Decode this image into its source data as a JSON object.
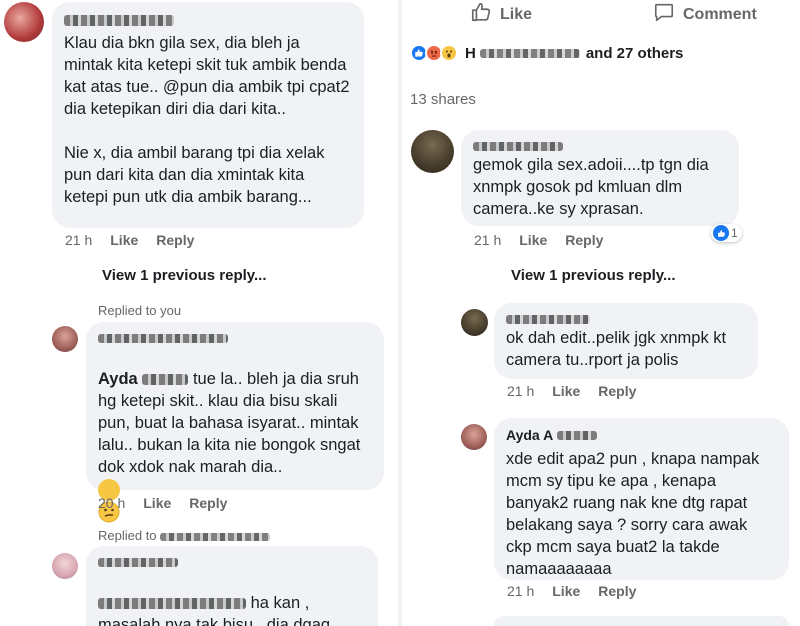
{
  "post_actions": {
    "like": "Like",
    "comment": "Comment"
  },
  "reactions": {
    "summary": "and 27 others"
  },
  "shares": "13 shares",
  "left": {
    "comment1": {
      "text": "Klau dia bkn gila sex, dia bleh ja mintak kita ketepi skit tuk ambik benda kat atas tue.. @pun dia ambik tpi cpat2 dia ketepikan diri dia dari kita..\n\nNie x, dia ambil barang tpi dia xelak pun dari kita dan dia xmintak kita ketepi pun utk dia ambik barang...",
      "time": "21 h",
      "like": "Like",
      "reply": "Reply"
    },
    "view_previous": "View 1 previous reply...",
    "replied_to_you": "Replied to you",
    "comment2": {
      "name": "Ayda",
      "text_first": "tue la.. bleh ja dia sruh",
      "text_rest": "hg ketepi skit.. klau dia bisu skali pun, buat la bahasa isyarat.. mintak lalu.. bukan la kita nie bongok sngat dok xdok nak marah dia..",
      "time": "20 h",
      "like": "Like",
      "reply": "Reply"
    },
    "replied_to": "Replied to",
    "comment3": {
      "text_first": "ha kan ,",
      "text_rest": "masalah nya tak bisu , dia dgaq"
    }
  },
  "right": {
    "comment1": {
      "text": "gemok gila sex.adoii....tp tgn dia xnmpk gosok pd kmluan dlm camera..ke sy xprasan.",
      "time": "21 h",
      "like": "Like",
      "reply": "Reply",
      "like_count": "1"
    },
    "view_previous": "View 1 previous reply...",
    "comment2": {
      "text": "ok dah edit..pelik jgk xnmpk kt camera tu..rport ja polis",
      "time": "21 h",
      "like": "Like",
      "reply": "Reply"
    },
    "comment3": {
      "name": "Ayda A",
      "text": "xde edit apa2 pun , knapa nampak mcm sy tipu ke apa , kenapa banyak2 ruang nak kne dtg rapat belakang saya ? sorry cara awak ckp mcm saya buat2 la takde namaaaaaaaa",
      "time": "21 h",
      "like": "Like",
      "reply": "Reply"
    }
  },
  "colors": {
    "bubble": "#f0f2f5",
    "meta": "#65676b",
    "like_blue": "#1877f2",
    "angry": "#f0684a",
    "wow": "#f7c744"
  }
}
